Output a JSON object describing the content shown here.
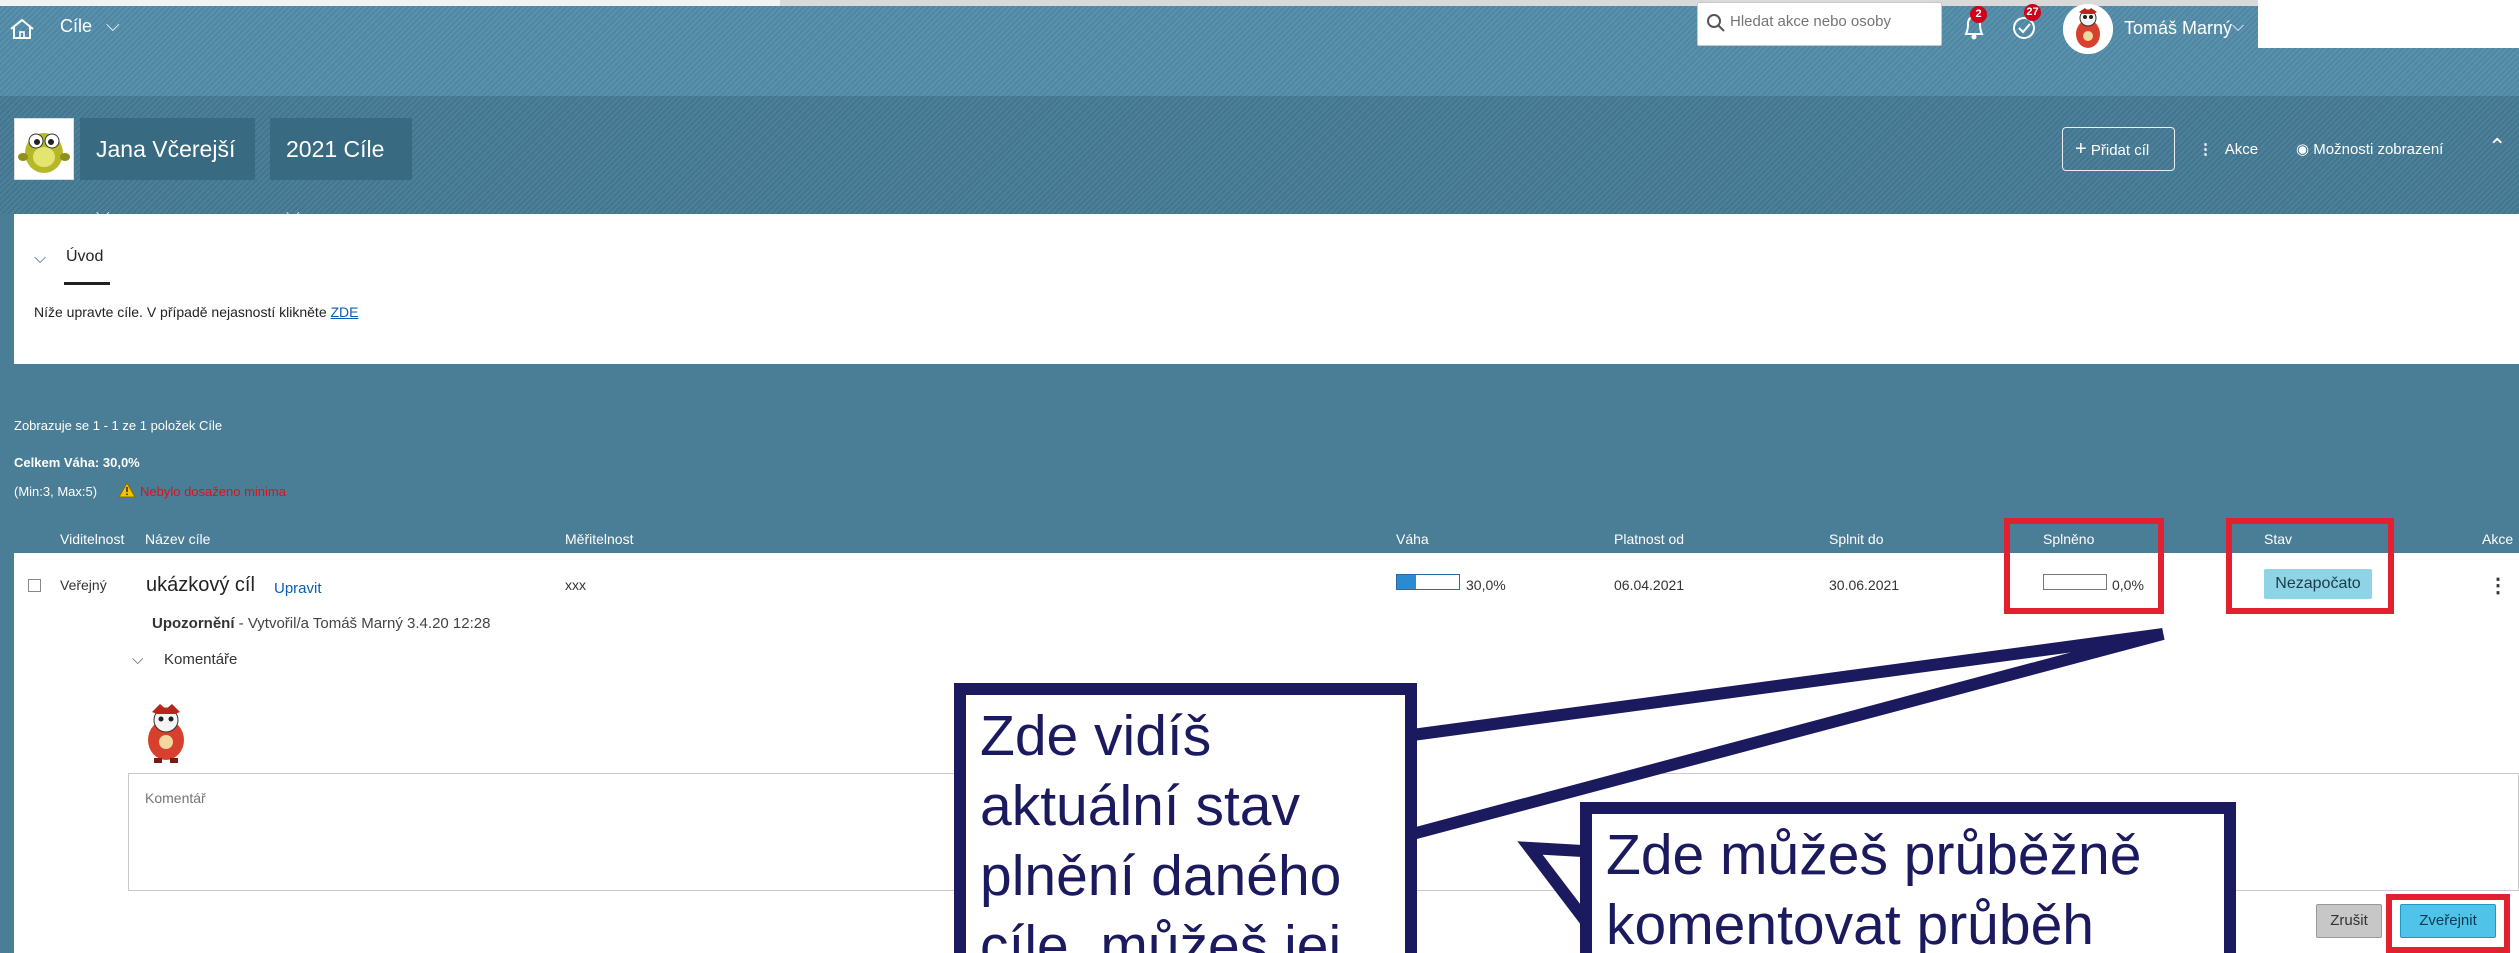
{
  "shell": {
    "app_title": "Cíle",
    "search_placeholder": "Hledat akce nebo osoby",
    "notifications_count": "2",
    "todo_count": "27",
    "user_name": "Tomáš Marný"
  },
  "header": {
    "owner_name": "Jana Včerejší",
    "goal_plan": "2021 Cíle",
    "add_goal": "Přidat cíl",
    "actions": "Akce",
    "view_options": "Možnosti zobrazení"
  },
  "intro": {
    "title": "Úvod",
    "text": "Níže upravte cíle. V případě nejasností klikněte",
    "link": "ZDE"
  },
  "summary": {
    "count": "Zobrazuje se 1 - 1 ze 1 položek Cíle",
    "total_weight": "Celkem Váha: 30,0%",
    "min_max": "(Min:3, Max:5)",
    "warning": "Nebylo dosaženo minima"
  },
  "table": {
    "headers": {
      "visibility": "Viditelnost",
      "name": "Název cíle",
      "metric": "Měřitelnost",
      "weight": "Váha",
      "valid_from": "Platnost od",
      "due": "Splnit do",
      "done": "Splněno",
      "status": "Stav",
      "actions": "Akce"
    },
    "row": {
      "visibility": "Veřejný",
      "name": "ukázkový cíl",
      "edit": "Upravit",
      "metric": "xxx",
      "weight": "30,0%",
      "weight_fraction": 0.3,
      "valid_from": "06.04.2021",
      "due": "30.06.2021",
      "done": "0,0%",
      "done_fraction": 0.0,
      "status": "Nezapočato",
      "warning_label": "Upozornění",
      "warning_text": "- Vytvořil/a Tomáš Marný 3.4.20 12:28"
    },
    "comments": {
      "toggle": "Komentáře",
      "placeholder": "Komentář",
      "cancel": "Zrušit",
      "publish": "Zveřejnit"
    }
  },
  "callouts": {
    "first": [
      "Zde vidíš",
      "aktuální stav",
      "plnění daného",
      "cíle, můžeš jej"
    ],
    "second": [
      "Zde můžeš průběžně",
      "komentovat průběh"
    ]
  },
  "colors": {
    "highlight": "#e3202f",
    "callout": "#1c1a5e",
    "status_badge": "#8fd3e6"
  }
}
